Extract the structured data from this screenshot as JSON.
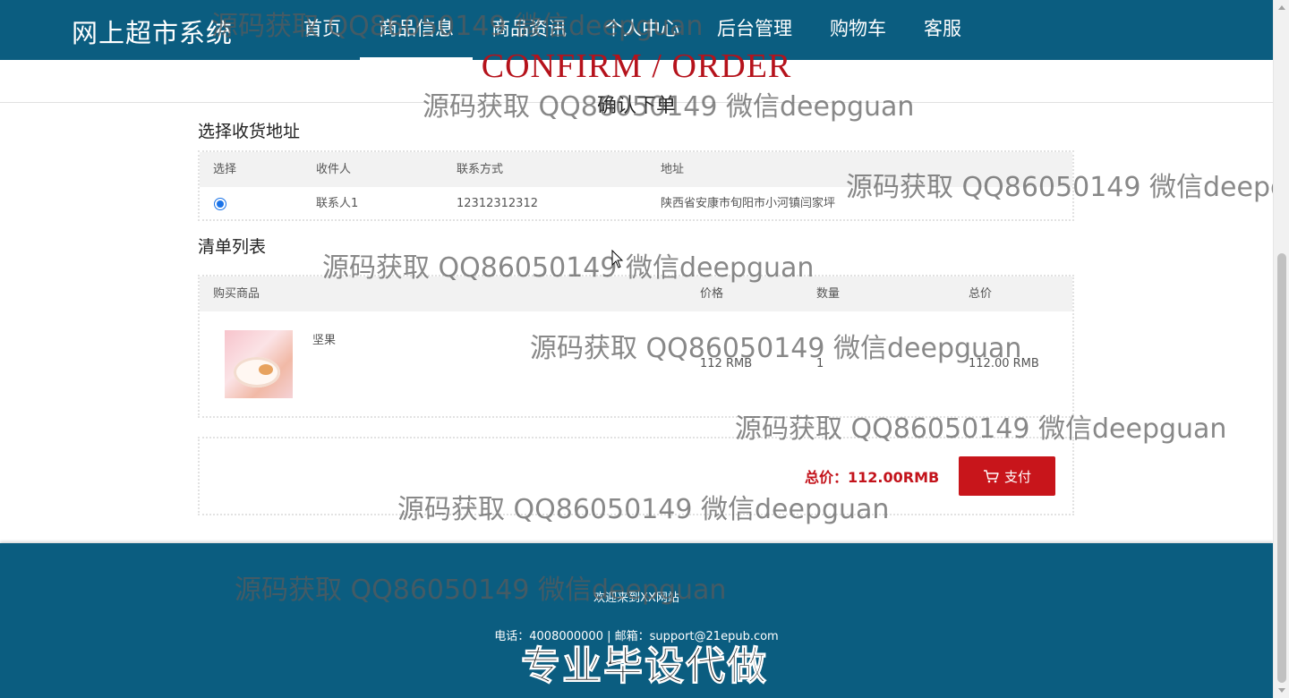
{
  "header": {
    "brand": "网上超市系统",
    "nav": [
      {
        "label": "首页"
      },
      {
        "label": "商品信息"
      },
      {
        "label": "商品资讯"
      },
      {
        "label": "个人中心"
      },
      {
        "label": "后台管理"
      },
      {
        "label": "购物车"
      },
      {
        "label": "客服"
      }
    ],
    "active_nav": "商品信息"
  },
  "page": {
    "heading_en": "CONFIRM / ORDER",
    "heading_cn": "确认下单"
  },
  "address": {
    "section_title": "选择收货地址",
    "columns": [
      "选择",
      "收件人",
      "联系方式",
      "地址"
    ],
    "rows": [
      {
        "selected": true,
        "recipient": "联系人1",
        "phone": "12312312312",
        "address": "陕西省安康市旬阳市小河镇闫家坪"
      }
    ]
  },
  "order_list": {
    "section_title": "清单列表",
    "columns": [
      "购买商品",
      "价格",
      "数量",
      "总价"
    ],
    "items": [
      {
        "name": "坚果",
        "price": "112 RMB",
        "quantity": "1",
        "total": "112.00 RMB"
      }
    ]
  },
  "summary": {
    "total_label": "总价：112.00RMB",
    "pay_label": "支付"
  },
  "footer": {
    "welcome": "欢迎来到XX网站",
    "contact": "电话：4008000000 | 邮箱：support@21epub.com"
  },
  "watermarks": {
    "text": "源码获取 QQ86050149 微信deepguan",
    "stamp": "专业毕设代做"
  },
  "colors": {
    "header_bg": "#0b5d80",
    "accent_red": "#c8151b",
    "heading_red": "#b5121b"
  }
}
